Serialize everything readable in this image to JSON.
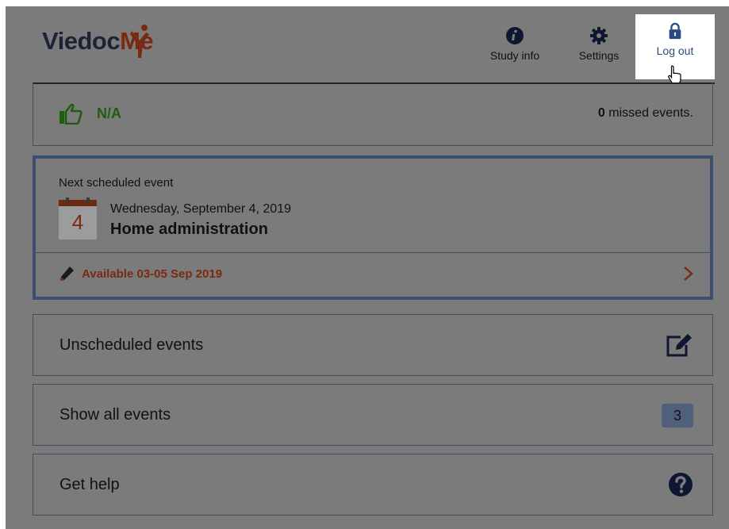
{
  "header": {
    "logo_main": "Viedoc",
    "logo_accent": "Me",
    "nav": {
      "study_info": "Study info",
      "settings": "Settings",
      "log_out": "Log out"
    }
  },
  "status": {
    "compliance": "N/A",
    "missed_count": "0",
    "missed_suffix": "missed events."
  },
  "next_event": {
    "label": "Next scheduled event",
    "day": "4",
    "date": "Wednesday, September 4, 2019",
    "name": "Home administration",
    "availability": "Available 03-05 Sep 2019"
  },
  "rows": {
    "unscheduled": "Unscheduled events",
    "show_all": "Show all events",
    "show_all_count": "3",
    "get_help": "Get help"
  },
  "icons": {
    "study_info": "info-circle-icon",
    "settings": "gear-icon",
    "log_out": "lock-icon",
    "status": "thumbs-up-icon",
    "calendar": "calendar-icon",
    "availability": "pencil-icon",
    "open": "chevron-right-icon",
    "unscheduled": "edit-square-icon",
    "help": "question-circle-icon"
  },
  "colors": {
    "brand_dark": "#1b2436",
    "brand_accent": "#7a2a12",
    "status_green": "#1f5c0e",
    "frame_blue": "#3b4f70"
  }
}
